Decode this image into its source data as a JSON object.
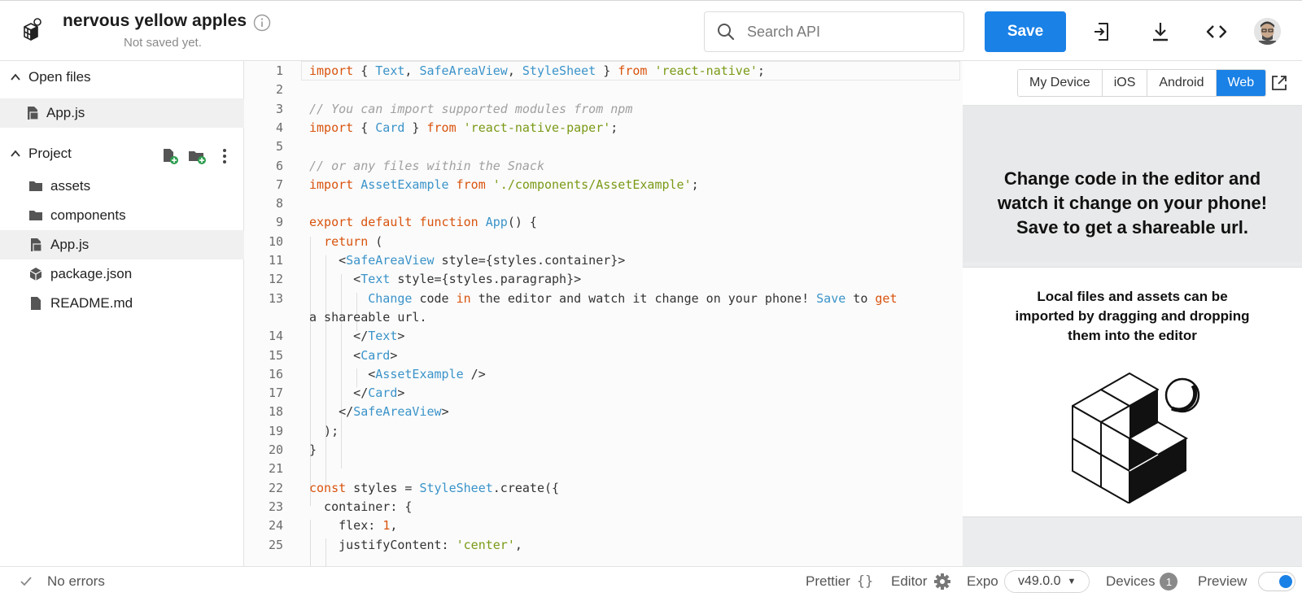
{
  "header": {
    "project_name": "nervous yellow apples",
    "save_status": "Not saved yet.",
    "search_placeholder": "Search API",
    "save_label": "Save",
    "icons": [
      "snack-logo-icon",
      "info-icon",
      "search-icon",
      "import-icon",
      "download-icon",
      "embed-code-icon",
      "user-avatar"
    ]
  },
  "sidebar": {
    "open_files_label": "Open files",
    "open_files": [
      {
        "label": "App.js",
        "icon": "js-file-icon"
      }
    ],
    "project_label": "Project",
    "project_items": [
      {
        "label": "assets",
        "icon": "folder-icon"
      },
      {
        "label": "components",
        "icon": "folder-icon"
      },
      {
        "label": "App.js",
        "icon": "js-file-icon",
        "active": true
      },
      {
        "label": "package.json",
        "icon": "package-icon"
      },
      {
        "label": "README.md",
        "icon": "file-icon"
      }
    ]
  },
  "editor": {
    "line_numbers": [
      "1",
      "2",
      "3",
      "4",
      "5",
      "6",
      "7",
      "8",
      "9",
      "10",
      "11",
      "12",
      "13",
      "",
      "14",
      "15",
      "16",
      "17",
      "18",
      "19",
      "20",
      "21",
      "22",
      "23",
      "24",
      "25"
    ],
    "code_lines": [
      "import { Text, SafeAreaView, StyleSheet } from 'react-native';",
      "",
      "// You can import supported modules from npm",
      "import { Card } from 'react-native-paper';",
      "",
      "// or any files within the Snack",
      "import AssetExample from './components/AssetExample';",
      "",
      "export default function App() {",
      "  return (",
      "    <SafeAreaView style={styles.container}>",
      "      <Text style={styles.paragraph}>",
      "        Change code in the editor and watch it change on your phone! Save to get",
      "a shareable url.",
      "      </Text>",
      "      <Card>",
      "        <AssetExample />",
      "      </Card>",
      "    </SafeAreaView>",
      "  );",
      "}",
      "",
      "const styles = StyleSheet.create({",
      "  container: {",
      "    flex: 1,",
      "    justifyContent: 'center',"
    ]
  },
  "preview": {
    "tabs": [
      "My Device",
      "iOS",
      "Android",
      "Web"
    ],
    "active_tab": "Web",
    "headline": "Change code in the editor and watch it change on your phone! Save to get a shareable url.",
    "card_text": "Local files and assets can be imported by dragging and dropping them into the editor"
  },
  "statusbar": {
    "errors": "No errors",
    "prettier": "Prettier",
    "editor": "Editor",
    "expo": "Expo",
    "sdk_version": "v49.0.0",
    "devices": "Devices",
    "devices_count": "1",
    "preview": "Preview",
    "preview_enabled": true
  },
  "colors": {
    "accent": "#1a81e6",
    "keyword": "#d9530d",
    "type": "#3a93c9",
    "string": "#7a9a16",
    "comment": "#a0a0a0"
  }
}
